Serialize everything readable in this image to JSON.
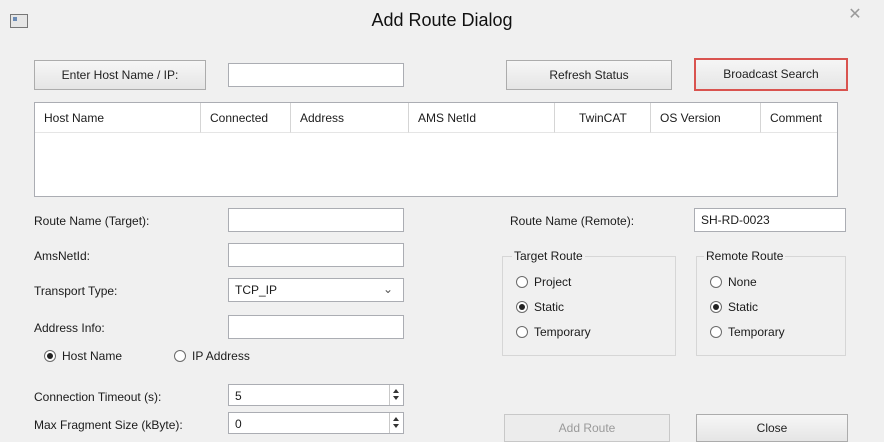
{
  "window": {
    "title": "Add Route Dialog",
    "close_label": "✕"
  },
  "search": {
    "host_button": "Enter Host Name / IP:",
    "host_value": "",
    "refresh_button": "Refresh Status",
    "broadcast_button": "Broadcast Search"
  },
  "table": {
    "columns": [
      "Host Name",
      "Connected",
      "Address",
      "AMS NetId",
      "TwinCAT",
      "OS Version",
      "Comment"
    ],
    "rows": []
  },
  "form": {
    "route_name_target_label": "Route Name (Target):",
    "route_name_target_value": "",
    "amsnetid_label": "AmsNetId:",
    "amsnetid_value": "",
    "transport_label": "Transport Type:",
    "transport_value": "TCP_IP",
    "address_info_label": "Address Info:",
    "address_info_value": "",
    "host_name_option": "Host Name",
    "ip_address_option": "IP Address",
    "address_mode_selected": "Host Name",
    "timeout_label": "Connection Timeout (s):",
    "timeout_value": "5",
    "fragment_label": "Max Fragment Size (kByte):",
    "fragment_value": "0",
    "route_name_remote_label": "Route Name (Remote):",
    "route_name_remote_value": "SH-RD-0023"
  },
  "target_route": {
    "legend": "Target Route",
    "options": [
      "Project",
      "Static",
      "Temporary"
    ],
    "selected": "Static"
  },
  "remote_route": {
    "legend": "Remote Route",
    "options": [
      "None",
      "Static",
      "Temporary"
    ],
    "selected": "Static"
  },
  "footer": {
    "add_route": "Add Route",
    "close": "Close"
  },
  "colors": {
    "focus_border": "#d9534f",
    "background": "#f0f0f0"
  }
}
